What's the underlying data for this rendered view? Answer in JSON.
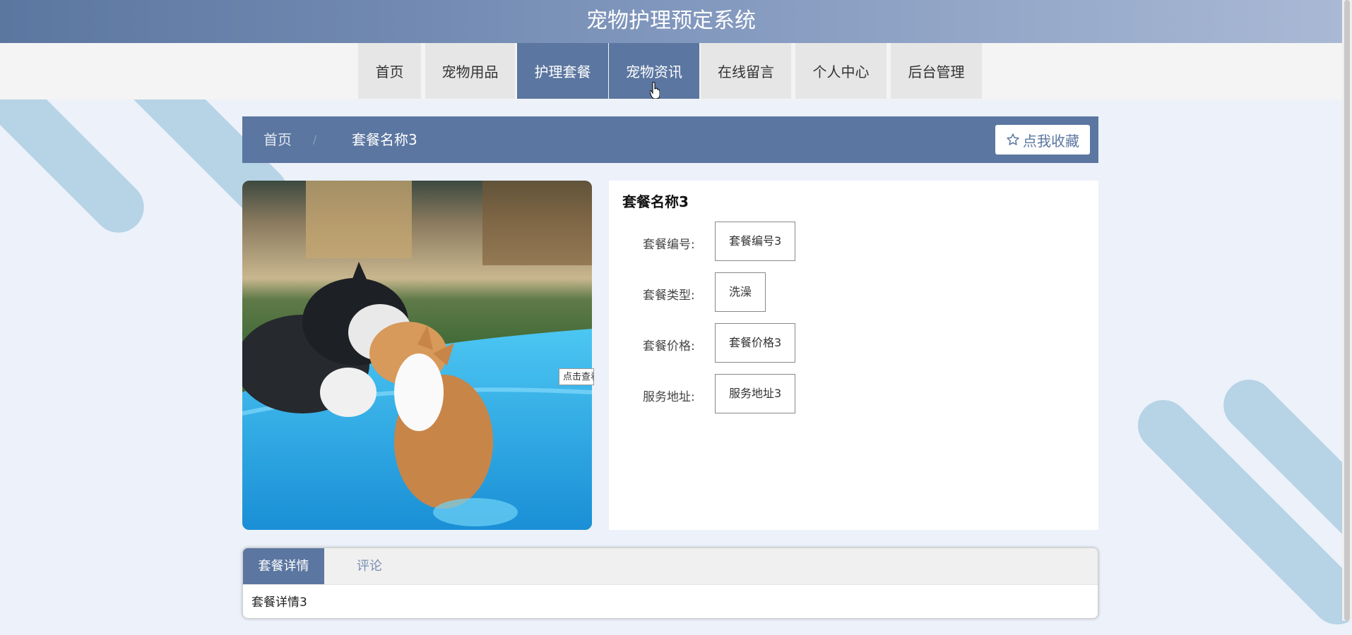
{
  "header": {
    "title": "宠物护理预定系统"
  },
  "nav": {
    "items": [
      {
        "label": "首页"
      },
      {
        "label": "宠物用品"
      },
      {
        "label": "护理套餐"
      },
      {
        "label": "宠物资讯"
      },
      {
        "label": "在线留言"
      },
      {
        "label": "个人中心"
      },
      {
        "label": "后台管理"
      }
    ],
    "active_label": "护理套餐"
  },
  "breadcrumb": {
    "home": "首页",
    "separator": "/",
    "current": "套餐名称3"
  },
  "favorite_button": {
    "label": "点我收藏",
    "icon": "star-outline-icon"
  },
  "photo": {
    "tooltip": "点击查看大图"
  },
  "detail": {
    "title": "套餐名称3",
    "fields": [
      {
        "label": "套餐编号:",
        "value": "套餐编号3"
      },
      {
        "label": "套餐类型:",
        "value": "洗澡"
      },
      {
        "label": "套餐价格:",
        "value": "套餐价格3"
      },
      {
        "label": "服务地址:",
        "value": "服务地址3"
      }
    ]
  },
  "tabs": {
    "items": [
      {
        "label": "套餐详情"
      },
      {
        "label": "评论"
      }
    ],
    "active_index": 0,
    "content": "套餐详情3"
  },
  "colors": {
    "primary": "#5b76a0",
    "page_background": "#ecf1fa",
    "decoration": "#b7d3e6"
  }
}
